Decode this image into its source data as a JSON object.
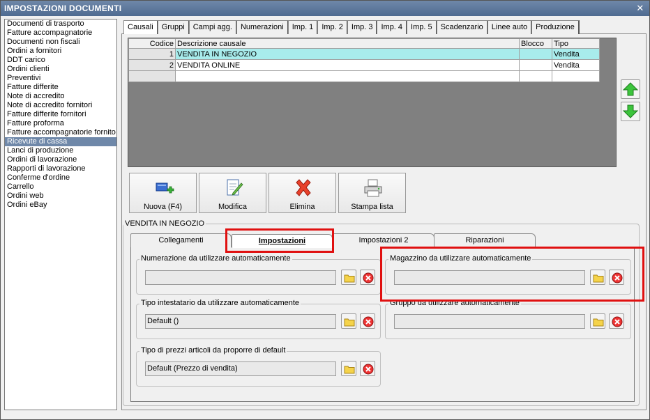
{
  "window": {
    "title": "IMPOSTAZIONI DOCUMENTI",
    "close_glyph": "✕"
  },
  "doc_list": [
    "Documenti di trasporto",
    "Fatture accompagnatorie",
    "Documenti non fiscali",
    "Ordini a fornitori",
    "DDT carico",
    "Ordini clienti",
    "Preventivi",
    "Fatture differite",
    "Note di accredito",
    "Note di accredito fornitori",
    "Fatture differite fornitori",
    "Fatture proforma",
    "Fatture accompagnatorie fornito",
    "Ricevute di cassa",
    "Lanci di produzione",
    "Ordini di lavorazione",
    "Rapporti di lavorazione",
    "Conferme d'ordine",
    "Carrello",
    "Ordini web",
    "Ordini eBay"
  ],
  "doc_list_selected": "Ricevute di cassa",
  "main_tabs": [
    "Causali",
    "Gruppi",
    "Campi agg.",
    "Numerazioni",
    "Imp. 1",
    "Imp. 2",
    "Imp. 3",
    "Imp. 4",
    "Imp. 5",
    "Scadenzario",
    "Linee auto",
    "Produzione"
  ],
  "main_tab_active": "Causali",
  "grid": {
    "columns": [
      "Codice",
      "Descrizione causale",
      "Blocco",
      "Tipo"
    ],
    "rows": [
      {
        "codice": "1",
        "descrizione": "VENDITA IN NEGOZIO",
        "blocco": "",
        "tipo": "Vendita"
      },
      {
        "codice": "2",
        "descrizione": "VENDITA ONLINE",
        "blocco": "",
        "tipo": "Vendita"
      }
    ]
  },
  "toolbar": {
    "nuova": "Nuova (F4)",
    "modifica": "Modifica",
    "elimina": "Elimina",
    "stampa": "Stampa lista"
  },
  "detail": {
    "group_title": "VENDITA IN NEGOZIO",
    "tabs": [
      "Collegamenti",
      "Impostazioni",
      "Impostazioni 2",
      "Riparazioni"
    ],
    "active_tab": "Impostazioni",
    "fields": {
      "numerazione": {
        "label": "Numerazione da utilizzare automaticamente",
        "value": ""
      },
      "magazzino": {
        "label": "Magazzino da utilizzare automaticamente",
        "value": ""
      },
      "intestatario": {
        "label": "Tipo intestatario da utilizzare automaticamente",
        "value": "Default ()"
      },
      "gruppo": {
        "label": "Gruppo da utilizzare automaticamente",
        "value": ""
      },
      "prezzi": {
        "label": "Tipo di prezzi articoli da proporre di default",
        "value": "Default (Prezzo di vendita)"
      }
    }
  },
  "colors": {
    "title_bar": "#5b7699",
    "selection": "#6f88a9",
    "grid_selected": "#a8ecec",
    "highlight": "#e01010"
  }
}
